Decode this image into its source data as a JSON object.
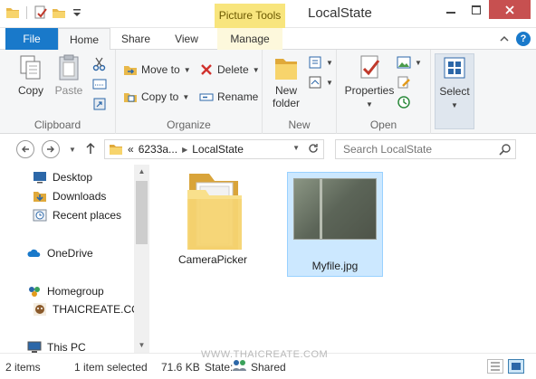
{
  "window": {
    "title": "LocalState",
    "contextual_tab_group": "Picture Tools",
    "buttons": [
      "minimize",
      "maximize",
      "close"
    ]
  },
  "tabs": [
    "File",
    "Home",
    "Share",
    "View",
    "Manage"
  ],
  "ribbon": {
    "clipboard": {
      "label": "Clipboard",
      "copy": "Copy",
      "paste": "Paste"
    },
    "organize": {
      "label": "Organize",
      "move_to": "Move to",
      "copy_to": "Copy to",
      "delete": "Delete",
      "rename": "Rename"
    },
    "new": {
      "label": "New",
      "new_folder_line1": "New",
      "new_folder_line2": "folder"
    },
    "open": {
      "label": "Open",
      "properties": "Properties"
    },
    "select": {
      "label": "Select"
    }
  },
  "address": {
    "crumbs": [
      "6233a...",
      "LocalState"
    ],
    "overflow": "«"
  },
  "search": {
    "placeholder": "Search LocalState"
  },
  "nav_pane": {
    "items": [
      {
        "label": "Desktop",
        "icon": "desktop-icon"
      },
      {
        "label": "Downloads",
        "icon": "downloads-icon"
      },
      {
        "label": "Recent places",
        "icon": "recent-places-icon"
      },
      {
        "label": "OneDrive",
        "icon": "onedrive-icon"
      },
      {
        "label": "Homegroup",
        "icon": "homegroup-icon"
      },
      {
        "label": "THAICREATE.CO",
        "icon": "user-avatar-icon"
      },
      {
        "label": "This PC",
        "icon": "this-pc-icon"
      }
    ]
  },
  "files": [
    {
      "name": "CameraPicker",
      "type": "folder",
      "selected": false
    },
    {
      "name": "Myfile.jpg",
      "type": "image",
      "selected": true
    }
  ],
  "status": {
    "item_count": "2 items",
    "selection": "1 item selected",
    "size": "71.6 KB",
    "state_label": "State:",
    "state_value": "Shared"
  },
  "watermark": "WWW.THAICREATE.COM",
  "colors": {
    "accent": "#1979ca",
    "contextual": "#f8e57d",
    "selection": "#cce8ff",
    "close": "#c75050"
  }
}
